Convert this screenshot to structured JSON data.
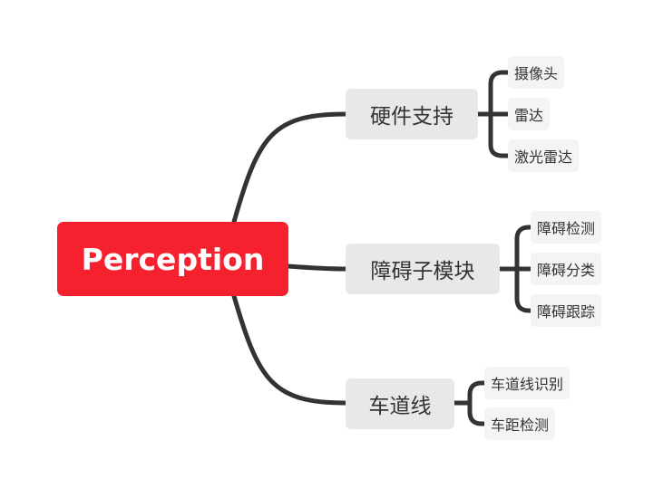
{
  "root": {
    "label": "Perception"
  },
  "branches": [
    {
      "label": "硬件支持",
      "children": [
        "摄像头",
        "雷达",
        "激光雷达"
      ]
    },
    {
      "label": "障碍子模块",
      "children": [
        "障碍检测",
        "障碍分类",
        "障碍跟踪"
      ]
    },
    {
      "label": "车道线",
      "children": [
        "车道线识别",
        "车距检测"
      ]
    }
  ],
  "colors": {
    "root": "#f5212f",
    "branch": "#e8e8e8",
    "leaf": "#f4f4f4",
    "line": "#333333"
  }
}
